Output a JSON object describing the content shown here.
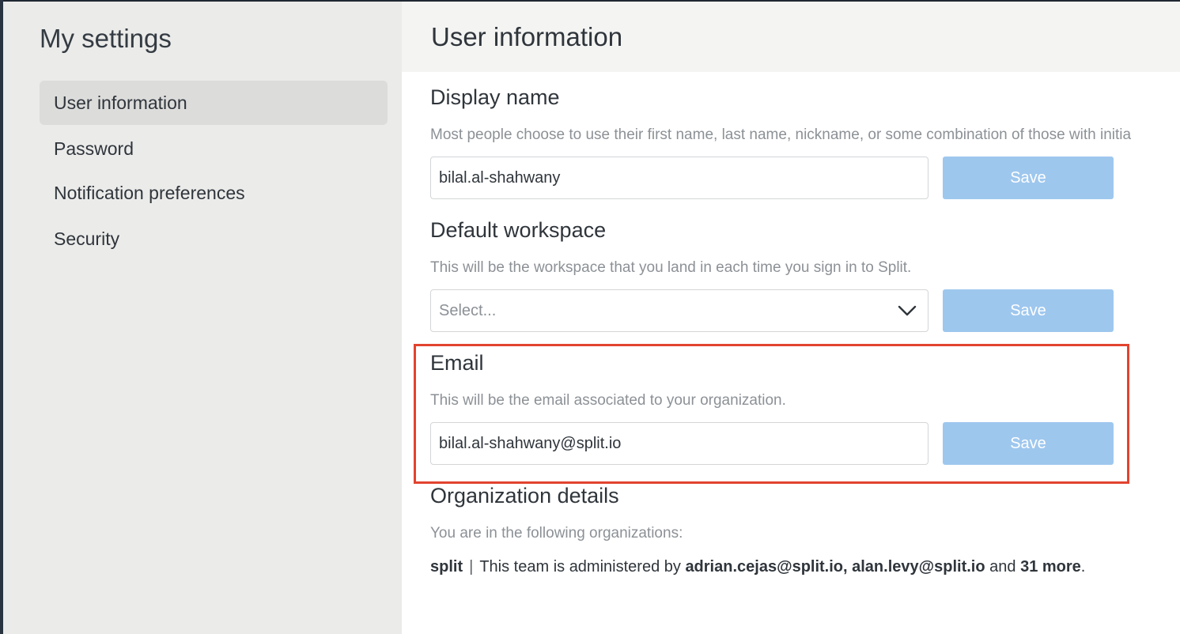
{
  "sidebar": {
    "title": "My settings",
    "items": [
      {
        "label": "User information",
        "active": true
      },
      {
        "label": "Password",
        "active": false
      },
      {
        "label": "Notification preferences",
        "active": false
      },
      {
        "label": "Security",
        "active": false
      }
    ]
  },
  "main": {
    "title": "User information",
    "display_name": {
      "title": "Display name",
      "description": "Most people choose to use their first name, last name, nickname, or some combination of those with initia",
      "value": "bilal.al-shahwany",
      "save_label": "Save"
    },
    "default_workspace": {
      "title": "Default workspace",
      "description": "This will be the workspace that you land in each time you sign in to Split.",
      "placeholder": "Select...",
      "save_label": "Save"
    },
    "email": {
      "title": "Email",
      "description": "This will be the email associated to your organization.",
      "value": "bilal.al-shahwany@split.io",
      "save_label": "Save"
    },
    "organization": {
      "title": "Organization details",
      "description": "You are in the following organizations:",
      "org_name": "split",
      "separator": "|",
      "admin_prefix": "This team is administered by",
      "admins": "adrian.cejas@split.io, alan.levy@split.io",
      "and_text": "and",
      "more": "31 more",
      "period": "."
    }
  },
  "colors": {
    "sidebar_bg": "#ebebea",
    "active_item_bg": "#dcdcdb",
    "header_bg": "#f4f4f3",
    "save_button_bg": "#9ec7ee",
    "highlight_border": "#e2432f",
    "muted_text": "#8c9196"
  },
  "icons": {
    "select_chevron": "chevron-down-icon"
  }
}
